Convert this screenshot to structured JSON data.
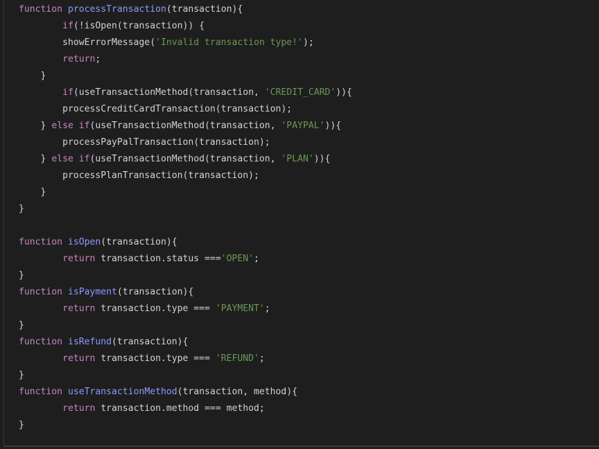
{
  "editor": {
    "theme": {
      "background": "#1e1e1e",
      "text": "#d4d4d4",
      "keyword": "#c586c0",
      "function_name": "#8a9cff",
      "string": "#6a9955"
    },
    "lines": [
      [
        {
          "t": "kw",
          "v": "function"
        },
        {
          "t": "plain",
          "v": " "
        },
        {
          "t": "fn",
          "v": "processTransaction"
        },
        {
          "t": "plain",
          "v": "(transaction){"
        }
      ],
      [
        {
          "t": "plain",
          "v": "        "
        },
        {
          "t": "kw",
          "v": "if"
        },
        {
          "t": "plain",
          "v": "(!isOpen(transaction)) {"
        }
      ],
      [
        {
          "t": "plain",
          "v": "        showErrorMessage("
        },
        {
          "t": "str",
          "v": "'Invalid transaction type!'"
        },
        {
          "t": "plain",
          "v": ");"
        }
      ],
      [
        {
          "t": "plain",
          "v": "        "
        },
        {
          "t": "kw",
          "v": "return"
        },
        {
          "t": "plain",
          "v": ";"
        }
      ],
      [
        {
          "t": "plain",
          "v": "    }"
        }
      ],
      [
        {
          "t": "plain",
          "v": "        "
        },
        {
          "t": "kw",
          "v": "if"
        },
        {
          "t": "plain",
          "v": "(useTransactionMethod(transaction, "
        },
        {
          "t": "str",
          "v": "'CREDIT_CARD'"
        },
        {
          "t": "plain",
          "v": ")){"
        }
      ],
      [
        {
          "t": "plain",
          "v": "        processCreditCardTransaction(transaction);"
        }
      ],
      [
        {
          "t": "plain",
          "v": "    } "
        },
        {
          "t": "kw",
          "v": "else if"
        },
        {
          "t": "plain",
          "v": "(useTransactionMethod(transaction, "
        },
        {
          "t": "str",
          "v": "'PAYPAL'"
        },
        {
          "t": "plain",
          "v": ")){"
        }
      ],
      [
        {
          "t": "plain",
          "v": "        processPayPalTransaction(transaction);"
        }
      ],
      [
        {
          "t": "plain",
          "v": "    } "
        },
        {
          "t": "kw",
          "v": "else if"
        },
        {
          "t": "plain",
          "v": "(useTransactionMethod(transaction, "
        },
        {
          "t": "str",
          "v": "'PLAN'"
        },
        {
          "t": "plain",
          "v": ")){"
        }
      ],
      [
        {
          "t": "plain",
          "v": "        processPlanTransaction(transaction);"
        }
      ],
      [
        {
          "t": "plain",
          "v": "    }"
        }
      ],
      [
        {
          "t": "plain",
          "v": "}"
        }
      ],
      [],
      [
        {
          "t": "kw",
          "v": "function"
        },
        {
          "t": "plain",
          "v": " "
        },
        {
          "t": "fn",
          "v": "isOpen"
        },
        {
          "t": "plain",
          "v": "(transaction){"
        }
      ],
      [
        {
          "t": "plain",
          "v": "        "
        },
        {
          "t": "kw",
          "v": "return"
        },
        {
          "t": "plain",
          "v": " transaction.status ==="
        },
        {
          "t": "str",
          "v": "'OPEN'"
        },
        {
          "t": "plain",
          "v": ";"
        }
      ],
      [
        {
          "t": "plain",
          "v": "}"
        }
      ],
      [
        {
          "t": "kw",
          "v": "function"
        },
        {
          "t": "plain",
          "v": " "
        },
        {
          "t": "fn",
          "v": "isPayment"
        },
        {
          "t": "plain",
          "v": "(transaction){"
        }
      ],
      [
        {
          "t": "plain",
          "v": "        "
        },
        {
          "t": "kw",
          "v": "return"
        },
        {
          "t": "plain",
          "v": " transaction.type === "
        },
        {
          "t": "str",
          "v": "'PAYMENT'"
        },
        {
          "t": "plain",
          "v": ";"
        }
      ],
      [
        {
          "t": "plain",
          "v": "}"
        }
      ],
      [
        {
          "t": "kw",
          "v": "function"
        },
        {
          "t": "plain",
          "v": " "
        },
        {
          "t": "fn",
          "v": "isRefund"
        },
        {
          "t": "plain",
          "v": "(transaction){"
        }
      ],
      [
        {
          "t": "plain",
          "v": "        "
        },
        {
          "t": "kw",
          "v": "return"
        },
        {
          "t": "plain",
          "v": " transaction.type === "
        },
        {
          "t": "str",
          "v": "'REFUND'"
        },
        {
          "t": "plain",
          "v": ";"
        }
      ],
      [
        {
          "t": "plain",
          "v": "}"
        }
      ],
      [
        {
          "t": "kw",
          "v": "function"
        },
        {
          "t": "plain",
          "v": " "
        },
        {
          "t": "fn",
          "v": "useTransactionMethod"
        },
        {
          "t": "plain",
          "v": "(transaction, method){"
        }
      ],
      [
        {
          "t": "plain",
          "v": "        "
        },
        {
          "t": "kw",
          "v": "return"
        },
        {
          "t": "plain",
          "v": " transaction.method === method;"
        }
      ],
      [
        {
          "t": "plain",
          "v": "}"
        }
      ]
    ]
  }
}
